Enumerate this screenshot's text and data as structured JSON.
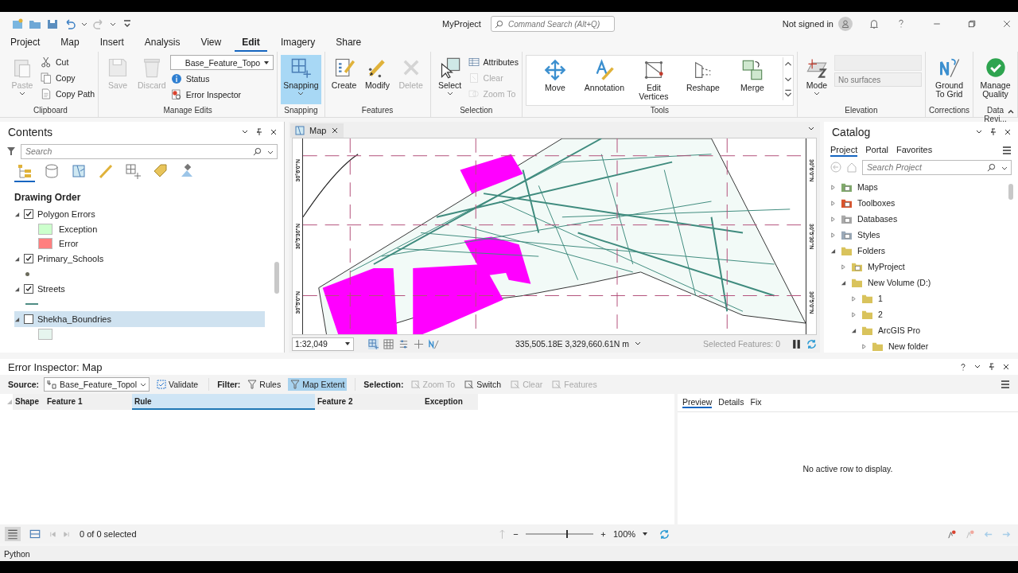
{
  "title_bar": {
    "title": "MyProject",
    "search_placeholder": "Command Search (Alt+Q)",
    "user": "Not signed in"
  },
  "ribbon_tabs": [
    {
      "label": "Project",
      "selected": false
    },
    {
      "label": "Map",
      "selected": false
    },
    {
      "label": "Insert",
      "selected": false
    },
    {
      "label": "Analysis",
      "selected": false
    },
    {
      "label": "View",
      "selected": false
    },
    {
      "label": "Edit",
      "selected": true
    },
    {
      "label": "Imagery",
      "selected": false
    },
    {
      "label": "Share",
      "selected": false
    }
  ],
  "ribbon": [
    {
      "name": "Clipboard",
      "kind": "buttons",
      "items": [
        {
          "kind": "large-menu",
          "label": "Paste",
          "disabled": true,
          "on": false
        },
        {
          "kind": "small",
          "label": "Cut",
          "disabled": false,
          "on": false
        },
        {
          "kind": "small",
          "label": "Copy",
          "disabled": false,
          "on": false
        },
        {
          "kind": "small",
          "label": "Copy Path",
          "disabled": false,
          "on": false
        }
      ]
    },
    {
      "name": "Manage Edits",
      "kind": "buttons",
      "items": [
        {
          "kind": "large",
          "label": "Save",
          "disabled": true,
          "on": false
        },
        {
          "kind": "large",
          "label": "Discard",
          "disabled": true,
          "on": false
        },
        {
          "kind": "combo",
          "label": "Base_Feature_Topo",
          "disabled": false
        },
        {
          "kind": "small",
          "label": "Status",
          "disabled": false,
          "on": false
        },
        {
          "kind": "small",
          "label": "Error Inspector",
          "disabled": false,
          "on": false
        }
      ]
    },
    {
      "name": "Snapping",
      "kind": "buttons",
      "items": [
        {
          "kind": "large-menu",
          "label": "Snapping",
          "disabled": false,
          "on": true
        }
      ]
    },
    {
      "name": "Features",
      "kind": "buttons",
      "items": [
        {
          "kind": "large",
          "label": "Create",
          "disabled": false,
          "on": false
        },
        {
          "kind": "large",
          "label": "Modify",
          "disabled": false,
          "on": false
        },
        {
          "kind": "large",
          "label": "Delete",
          "disabled": true,
          "on": false
        }
      ]
    },
    {
      "name": "Selection",
      "kind": "buttons",
      "items": [
        {
          "kind": "large-menu",
          "label": "Select",
          "disabled": false,
          "on": false
        },
        {
          "kind": "small",
          "label": "Attributes",
          "disabled": false,
          "on": false
        },
        {
          "kind": "small",
          "label": "Clear",
          "disabled": true,
          "on": false
        },
        {
          "kind": "small",
          "label": "Zoom To",
          "disabled": true,
          "on": false
        }
      ]
    },
    {
      "name": "Tools",
      "kind": "gallery",
      "items": [
        {
          "kind": "large",
          "label": "Move",
          "disabled": false,
          "on": false
        },
        {
          "kind": "large",
          "label": "Annotation",
          "disabled": false,
          "on": false
        },
        {
          "kind": "large",
          "label": "Edit Vertices",
          "disabled": false,
          "on": false
        },
        {
          "kind": "large",
          "label": "Reshape",
          "disabled": false,
          "on": false
        },
        {
          "kind": "large",
          "label": "Merge",
          "disabled": false,
          "on": false
        }
      ]
    },
    {
      "name": "Elevation",
      "kind": "buttons",
      "items": [
        {
          "kind": "large-menu",
          "label": "Mode",
          "disabled": false,
          "on": false
        },
        {
          "kind": "blank-combo",
          "disabled": true
        },
        {
          "kind": "field",
          "placeholder": "No surfaces",
          "disabled": true
        }
      ]
    },
    {
      "name": "Corrections",
      "kind": "buttons",
      "items": [
        {
          "kind": "large",
          "label": "Ground To Grid",
          "disabled": false,
          "on": false
        }
      ]
    },
    {
      "name": "Data Revi...",
      "kind": "buttons",
      "items": [
        {
          "kind": "large",
          "label": "Manage Quality",
          "disabled": false,
          "on": false
        }
      ]
    }
  ],
  "contents": {
    "title": "Contents",
    "search_placeholder": "Search",
    "views": [
      {
        "selected": true
      },
      {
        "selected": false
      },
      {
        "selected": false
      },
      {
        "selected": false
      },
      {
        "selected": false
      },
      {
        "selected": false
      },
      {
        "selected": false
      }
    ],
    "heading": "Drawing Order",
    "layers": [
      {
        "name": "Polygon Errors",
        "checked": true,
        "expanded": true,
        "selected": false,
        "legend": [
          {
            "kind": "swatch",
            "label": "Exception",
            "color": "#ccffcc"
          },
          {
            "kind": "swatch",
            "label": "Error",
            "color": "#ff7f7f"
          }
        ]
      },
      {
        "name": "Primary_Schools",
        "checked": true,
        "expanded": true,
        "selected": false,
        "legend": [
          {
            "kind": "point",
            "color": "#6b6b5c"
          }
        ]
      },
      {
        "name": "Streets",
        "checked": true,
        "expanded": true,
        "selected": false,
        "legend": [
          {
            "kind": "line",
            "color": "#4f8c84"
          }
        ]
      },
      {
        "name": "Shekha_Boundries",
        "checked": false,
        "expanded": true,
        "selected": true,
        "legend": [
          {
            "kind": "swatch",
            "color": "#e6f5ee"
          }
        ]
      }
    ]
  },
  "map": {
    "tab": "Map",
    "grid_labels_left": [
      "30°6'0\"N",
      "30°5'30\"N",
      "30°5'0\"N"
    ],
    "grid_labels_right": [
      "30°6'0\"N",
      "30°5'30\"N",
      "30°5'0\"N"
    ],
    "scale": "1:32,049",
    "coordinates": "335,505.18E 3,329,660.61N m",
    "selected_features": "Selected Features: 0"
  },
  "catalog": {
    "title": "Catalog",
    "tabs": [
      {
        "label": "Project",
        "selected": true
      },
      {
        "label": "Portal",
        "selected": false
      },
      {
        "label": "Favorites",
        "selected": false
      }
    ],
    "search_placeholder": "Search Project",
    "items": [
      {
        "label": "Maps",
        "kind": "maps",
        "expanded": false
      },
      {
        "label": "Toolboxes",
        "kind": "toolboxes",
        "expanded": false
      },
      {
        "label": "Databases",
        "kind": "databases",
        "expanded": false
      },
      {
        "label": "Styles",
        "kind": "styles",
        "expanded": false
      },
      {
        "label": "Folders",
        "kind": "folder",
        "expanded": true,
        "children": [
          {
            "label": "MyProject",
            "kind": "home",
            "expanded": false
          },
          {
            "label": "New Volume (D:)",
            "kind": "folder",
            "expanded": true,
            "children": [
              {
                "label": "1",
                "kind": "folder",
                "expanded": false
              },
              {
                "label": "2",
                "kind": "folder",
                "expanded": false
              },
              {
                "label": "ArcGIS Pro",
                "kind": "folder",
                "expanded": true,
                "children": [
                  {
                    "label": "New folder",
                    "kind": "folder",
                    "expanded": false
                  }
                ]
              }
            ]
          }
        ]
      }
    ]
  },
  "error_inspector": {
    "title": "Error Inspector: Map",
    "source_label": "Source:",
    "source": "Base_Feature_Topol",
    "validate": "Validate",
    "filter_label": "Filter:",
    "filters": [
      {
        "label": "Rules",
        "on": false
      },
      {
        "label": "Map Extent",
        "on": true
      }
    ],
    "selection_label": "Selection:",
    "selection_tools": [
      {
        "label": "Zoom To",
        "disabled": true
      },
      {
        "label": "Switch",
        "disabled": false
      },
      {
        "label": "Clear",
        "disabled": true
      },
      {
        "label": "Features",
        "disabled": true
      }
    ],
    "columns": [
      {
        "label": "Shape",
        "selected": false
      },
      {
        "label": "Feature 1",
        "selected": false
      },
      {
        "label": "Rule",
        "selected": true
      },
      {
        "label": "Feature 2",
        "selected": false
      },
      {
        "label": "Exception",
        "selected": false
      }
    ],
    "selected_count": "0 of 0 selected",
    "zoom_slider": {
      "level": 0.6
    },
    "zoom": "100%",
    "detail_tabs": [
      {
        "label": "Preview",
        "selected": true
      },
      {
        "label": "Details",
        "selected": false
      },
      {
        "label": "Fix",
        "selected": false
      }
    ],
    "empty_message": "No active row to display."
  },
  "status_bar": {
    "python": "Python"
  }
}
